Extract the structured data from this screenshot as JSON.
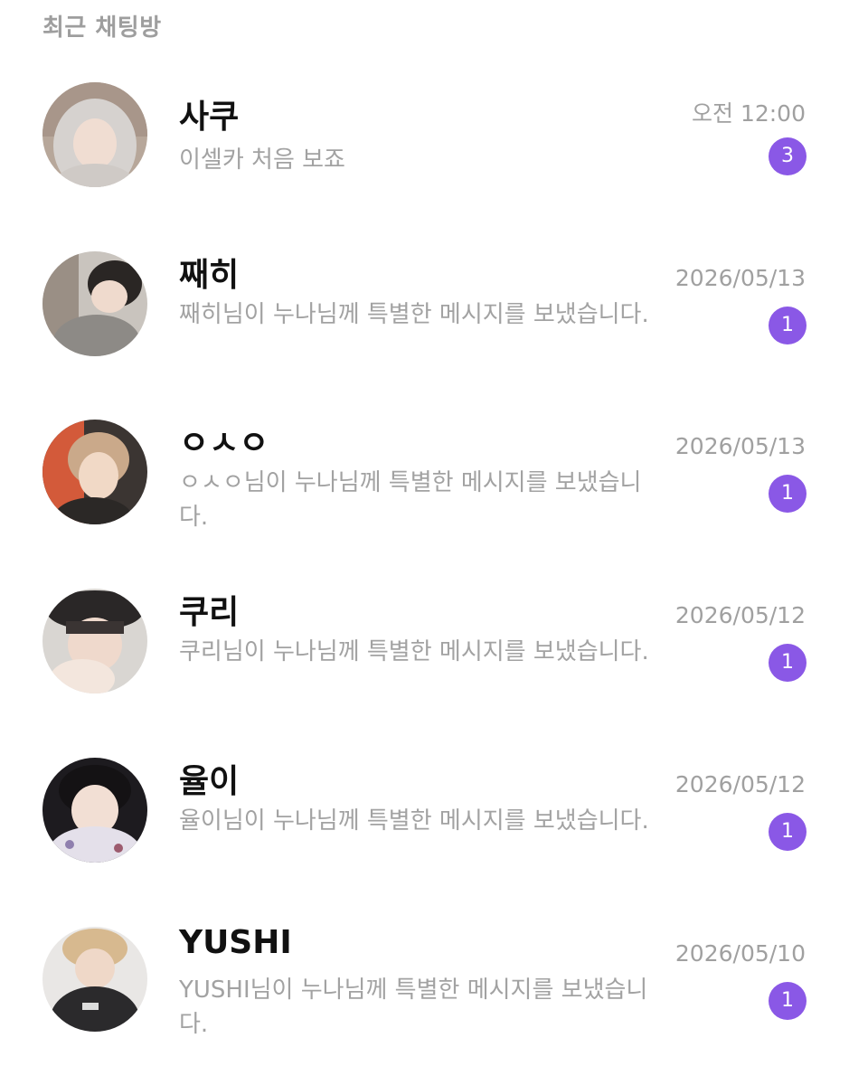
{
  "section_title": "최근 채팅방",
  "colors": {
    "badge": "#8a58e6",
    "name": "#111111",
    "secondary_text": "#a2a2a2"
  },
  "chats": [
    {
      "name": "사쿠",
      "message": "이셀카 처음 보죠",
      "time": "오전 12:00",
      "unread": "3"
    },
    {
      "name": "째히",
      "message": "째히님이 누나님께 특별한 메시지를 보냈습니다.",
      "time": "2026/05/13",
      "unread": "1"
    },
    {
      "name": "ㅇㅅㅇ",
      "message": "ㅇㅅㅇ님이 누나님께 특별한 메시지를 보냈습니다.",
      "time": "2026/05/13",
      "unread": "1"
    },
    {
      "name": "쿠리",
      "message": "쿠리님이 누나님께 특별한 메시지를 보냈습니다.",
      "time": "2026/05/12",
      "unread": "1"
    },
    {
      "name": "율이",
      "message": "율이님이 누나님께 특별한 메시지를 보냈습니다.",
      "time": "2026/05/12",
      "unread": "1"
    },
    {
      "name": "YUSHI",
      "message": "YUSHI님이 누나님께 특별한 메시지를 보냈습니다.",
      "time": "2026/05/10",
      "unread": "1"
    }
  ]
}
